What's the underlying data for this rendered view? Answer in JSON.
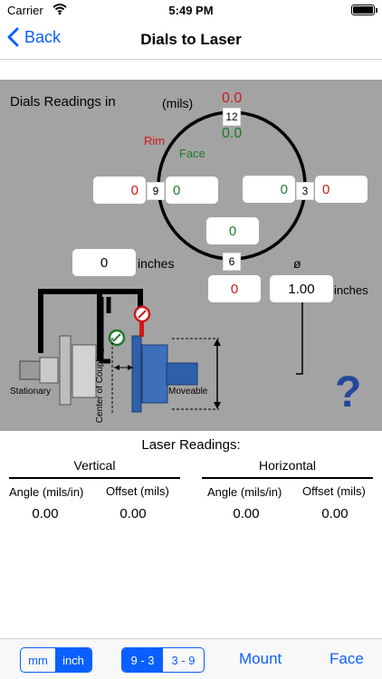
{
  "status": {
    "carrier": "Carrier",
    "time": "5:49 PM"
  },
  "nav": {
    "back_label": "Back",
    "title": "Dials to Laser"
  },
  "dials": {
    "heading": "Dials Readings in",
    "units": "(mils)",
    "rim_label": "Rim",
    "face_label": "Face",
    "top_rim": "0.0",
    "top_face": "0.0",
    "clock_12": "12",
    "clock_9": "9",
    "clock_3": "3",
    "clock_6": "6",
    "left_rim": "0",
    "left_face": "0",
    "right_face": "0",
    "right_rim": "0",
    "bottom_face": "0",
    "bottom_rim": "0",
    "distance_value": "0",
    "distance_unit": "inches",
    "diameter_symbol": "ø",
    "diameter_value": "1.00",
    "diameter_unit": "inches",
    "stationary_label": "Stationary",
    "moveable_label": "Moveable",
    "coupling_label": "Center of Coupling",
    "help_label": "?"
  },
  "laser": {
    "heading": "Laser Readings:",
    "vertical": {
      "title": "Vertical",
      "angle_label": "Angle (mils/in)",
      "offset_label": "Offset (mils)",
      "angle": "0.00",
      "offset": "0.00"
    },
    "horizontal": {
      "title": "Horizontal",
      "angle_label": "Angle (mils/in)",
      "offset_label": "Offset (mils)",
      "angle": "0.00",
      "offset": "0.00"
    }
  },
  "toolbar": {
    "unit_mm": "mm",
    "unit_inch": "inch",
    "pos_93": "9 - 3",
    "pos_39": "3 - 9",
    "mount": "Mount",
    "face": "Face"
  },
  "colors": {
    "accent": "#0a5fff",
    "rim": "#d01818",
    "face": "#1d7a2c",
    "panel": "#a3a3a3",
    "machine": "#2f5fa8"
  }
}
